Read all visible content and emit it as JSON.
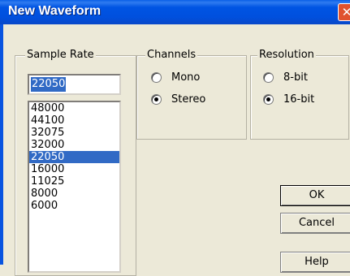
{
  "window": {
    "title": "New Waveform",
    "close_glyph": "✕"
  },
  "sample_rate": {
    "label": "Sample Rate",
    "input_value": "22050",
    "options": [
      "48000",
      "44100",
      "32075",
      "32000",
      "22050",
      "16000",
      "11025",
      "8000",
      "6000"
    ],
    "selected": "22050"
  },
  "channels": {
    "label": "Channels",
    "options": [
      {
        "label": "Mono",
        "checked": false
      },
      {
        "label": "Stereo",
        "checked": true
      }
    ]
  },
  "resolution": {
    "label": "Resolution",
    "options": [
      {
        "label": "8-bit",
        "checked": false
      },
      {
        "label": "16-bit",
        "checked": true
      }
    ]
  },
  "buttons": {
    "ok": "OK",
    "cancel": "Cancel",
    "help": "Help"
  }
}
